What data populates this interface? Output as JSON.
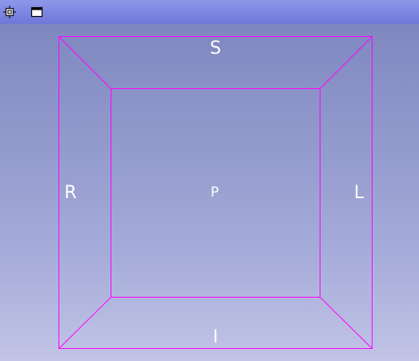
{
  "toolbar": {
    "pin_icon": "pin-icon",
    "maximize_icon": "maximize-icon"
  },
  "view": {
    "box_color": "#ff00ff",
    "label_color": "#ffffff",
    "labels": {
      "superior": "S",
      "inferior": "I",
      "right": "R",
      "left": "L",
      "posterior": "P"
    }
  }
}
